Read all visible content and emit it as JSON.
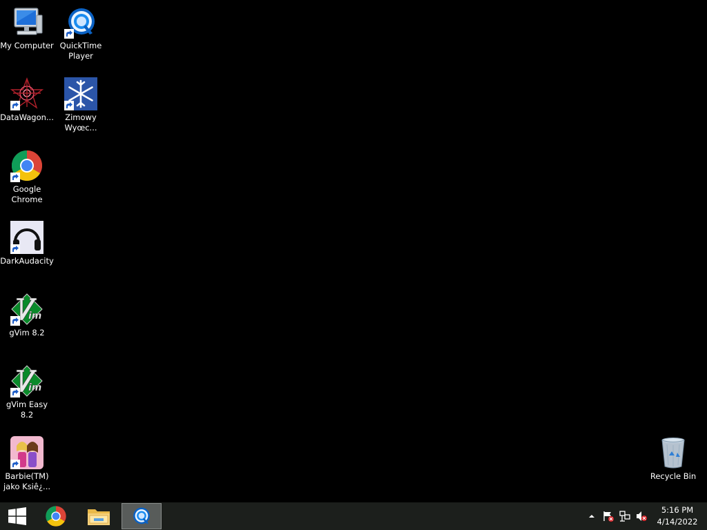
{
  "desktop": {
    "icons": [
      {
        "label": "My Computer",
        "icon": "computer-icon"
      },
      {
        "label": "QuickTime Player",
        "icon": "quicktime-icon"
      },
      {
        "label": "DataWagon...",
        "icon": "datawagon-icon"
      },
      {
        "label": "Zimowy Wyœc...",
        "icon": "snowflake-icon"
      },
      {
        "label": "Google Chrome",
        "icon": "chrome-icon"
      },
      {
        "label": "DarkAudacity",
        "icon": "headphones-icon"
      },
      {
        "label": "gVim 8.2",
        "icon": "vim-icon"
      },
      {
        "label": "gVim Easy 8.2",
        "icon": "vim-icon"
      },
      {
        "label": "Barbie(TM) jako Ksiê¿...",
        "icon": "barbie-icon"
      },
      {
        "label": "Recycle Bin",
        "icon": "recycle-bin-icon"
      }
    ]
  },
  "taskbar": {
    "start": {
      "icon": "windows-logo-icon"
    },
    "pinned": [
      {
        "name": "Google Chrome",
        "icon": "chrome-icon"
      },
      {
        "name": "File Explorer",
        "icon": "folder-icon"
      },
      {
        "name": "QuickTime Player",
        "icon": "quicktime-icon",
        "active": true
      }
    ],
    "tray": {
      "icons": [
        "chevron-up-icon",
        "action-center-flag-icon",
        "network-icon",
        "volume-muted-icon"
      ],
      "time": "5:16 PM",
      "date": "4/14/2022"
    }
  },
  "colors": {
    "desktop_bg": "#000000",
    "taskbar_bg": "#1c1f1c",
    "active_task_bg": "#585c5a"
  }
}
